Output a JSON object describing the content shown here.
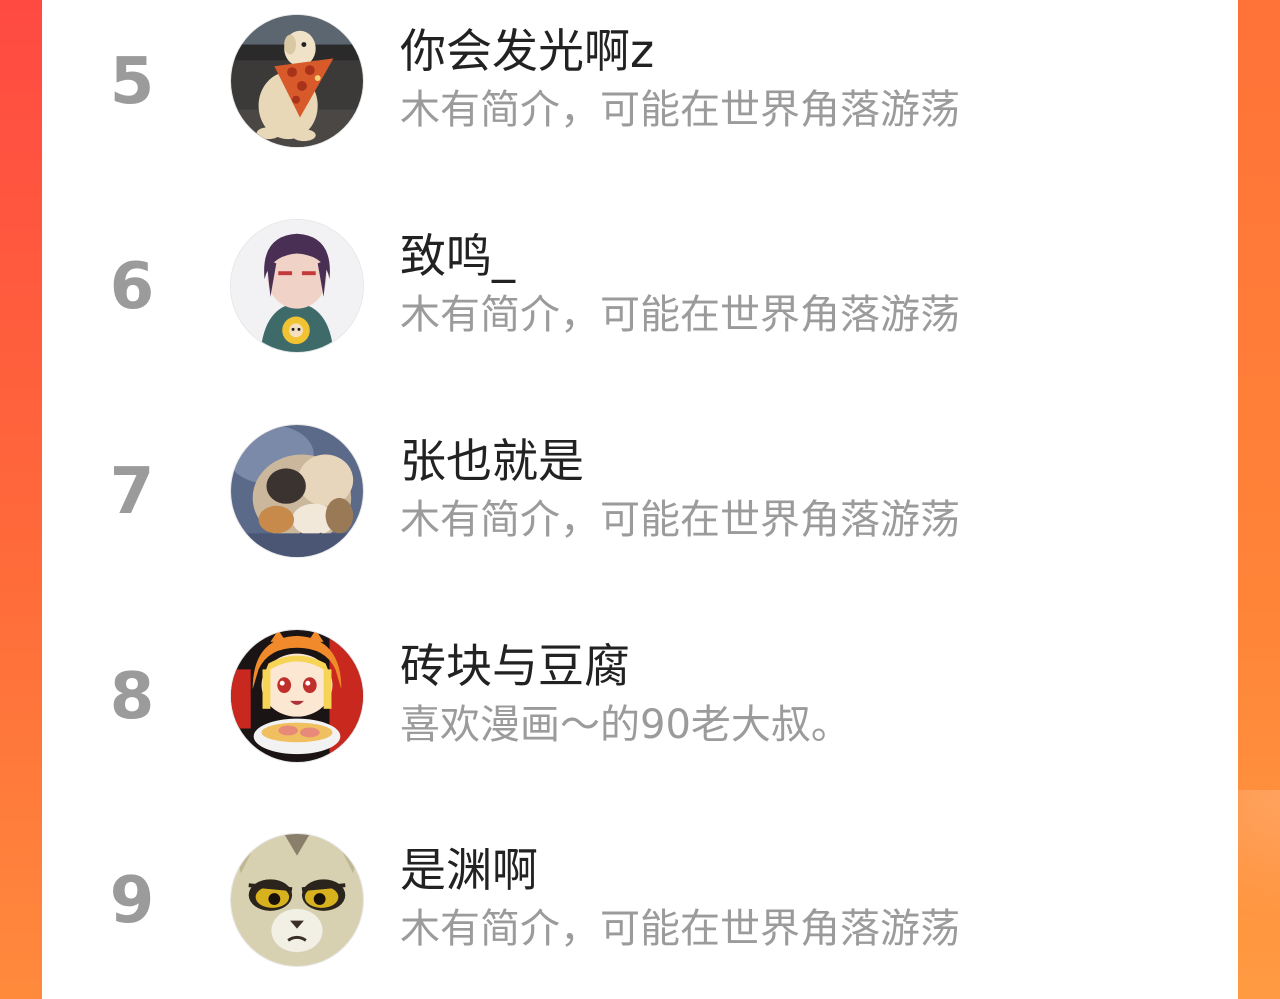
{
  "colors": {
    "background_gradient_start": "#ff4a42",
    "background_gradient_end": "#ff8a3c",
    "card": "#ffffff",
    "rank_text": "#9b9b9b",
    "name_text": "#222222",
    "bio_text": "#9b9b9b"
  },
  "ranking": {
    "entries": [
      {
        "rank": "5",
        "name": "你会发光啊z",
        "bio": "木有简介，可能在世界角落游荡",
        "avatar_icon": "dog-pizza-avatar"
      },
      {
        "rank": "6",
        "name": "致鸣_",
        "bio": "木有简介，可能在世界角落游荡",
        "avatar_icon": "anime-girl-flower-avatar"
      },
      {
        "rank": "7",
        "name": "张也就是",
        "bio": "木有简介，可能在世界角落游荡",
        "avatar_icon": "calico-cat-avatar"
      },
      {
        "rank": "8",
        "name": "砖块与豆腐",
        "bio": "喜欢漫画～的90老大叔。",
        "avatar_icon": "umaru-ramen-avatar"
      },
      {
        "rank": "9",
        "name": "是渊啊",
        "bio": "木有简介，可能在世界角落游荡",
        "avatar_icon": "grumpy-cat-cartoon-avatar"
      }
    ]
  }
}
